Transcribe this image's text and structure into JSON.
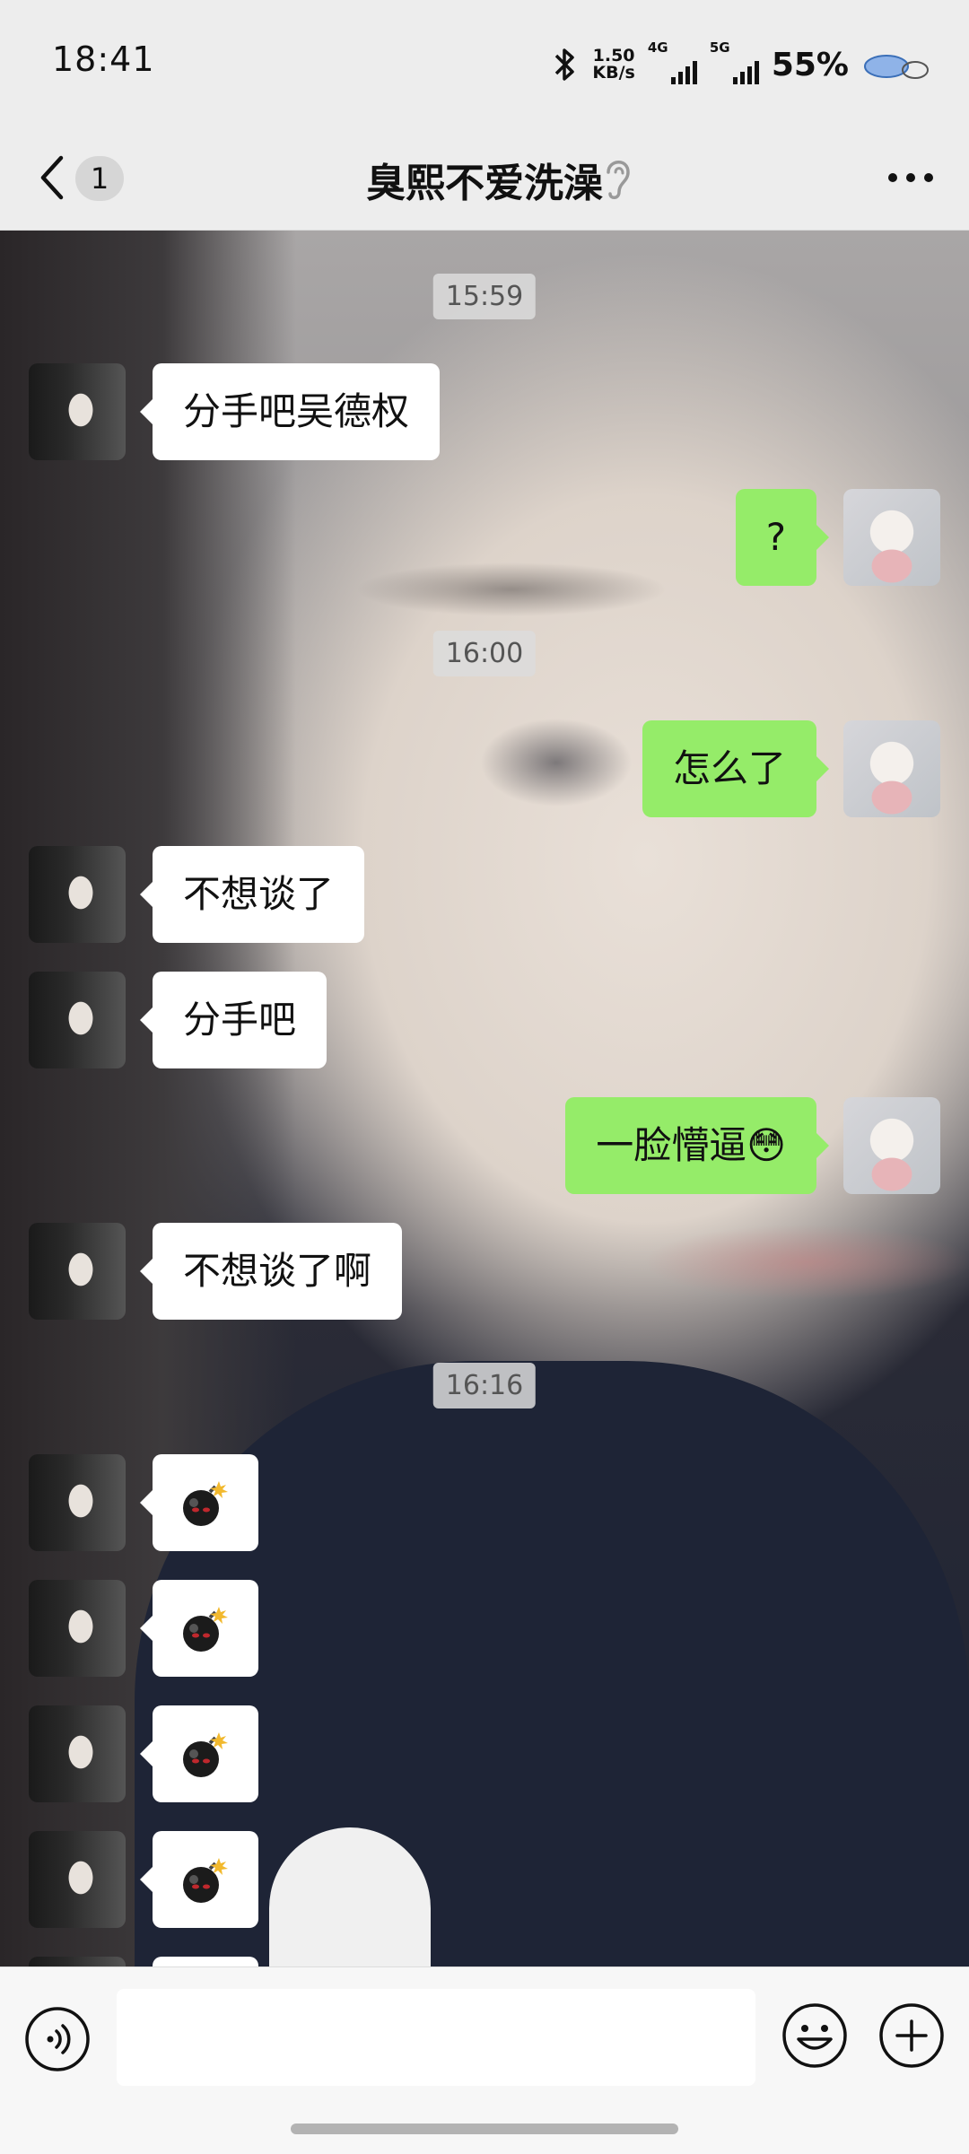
{
  "status_bar": {
    "time": "18:41",
    "net_speed_value": "1.50",
    "net_speed_unit": "KB/s",
    "signal_1_label": "4G",
    "signal_2_label": "5G",
    "battery": "55%"
  },
  "nav": {
    "unread_count": "1",
    "title": "臭熙不爱洗澡",
    "back_icon": "chevron-left-icon",
    "ear_icon": "ear-icon",
    "more_icon": "more-dots-icon"
  },
  "chat": {
    "timestamps": [
      "15:59",
      "16:00",
      "16:16"
    ],
    "messages": [
      {
        "from": "her",
        "text": "分手吧吴德权"
      },
      {
        "from": "me",
        "text": "?"
      },
      {
        "from": "me",
        "text": "怎么了"
      },
      {
        "from": "her",
        "text": "不想谈了"
      },
      {
        "from": "her",
        "text": "分手吧"
      },
      {
        "from": "me",
        "text": "一脸懵逼😳"
      },
      {
        "from": "her",
        "text": "不想谈了啊"
      },
      {
        "from": "her",
        "sticker": "bomb-icon"
      },
      {
        "from": "her",
        "sticker": "bomb-icon"
      },
      {
        "from": "her",
        "sticker": "bomb-icon"
      },
      {
        "from": "her",
        "sticker": "bomb-icon"
      }
    ]
  },
  "input_bar": {
    "placeholder": "",
    "value": ""
  },
  "colors": {
    "outgoing_bubble": "#95ec69",
    "incoming_bubble": "#ffffff",
    "bar_background": "#ededed"
  }
}
